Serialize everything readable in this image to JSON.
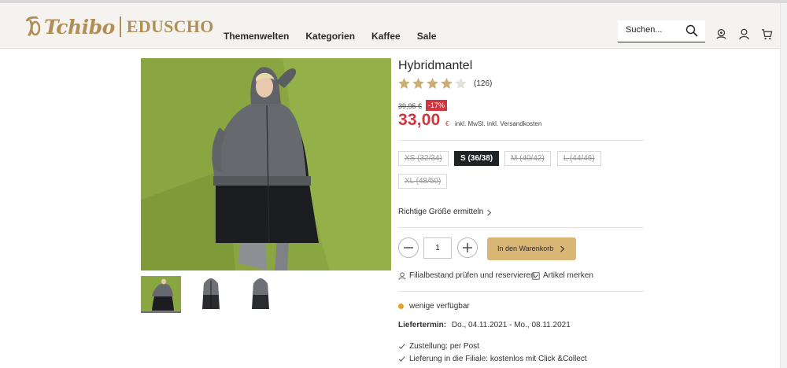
{
  "header": {
    "logo_primary": "Tchibo",
    "logo_secondary": "EDUSCHO",
    "nav": [
      "Themenwelten",
      "Kategorien",
      "Kaffee",
      "Sale"
    ],
    "search_placeholder": "Suchen...",
    "icons": [
      "search-icon",
      "store-locator-icon",
      "account-icon",
      "cart-icon"
    ]
  },
  "gallery": {
    "thumbnails": [
      "thumbnail-model",
      "thumbnail-coat-front",
      "thumbnail-coat-back"
    ],
    "active_index": 0
  },
  "product": {
    "title": "Hybridmantel",
    "rating": 4,
    "rating_max": 5,
    "review_count": "(126)",
    "old_price": "39,95 €",
    "discount": "-17%",
    "price": "33,00",
    "currency": "€",
    "price_note": "inkl. MwSt. inkl. Versandkosten",
    "sizes": [
      {
        "label": "XS (32/34)",
        "available": false,
        "selected": false
      },
      {
        "label": "S (36/38)",
        "available": true,
        "selected": true
      },
      {
        "label": "M (40/42)",
        "available": false,
        "selected": false
      },
      {
        "label": "L (44/46)",
        "available": false,
        "selected": false
      },
      {
        "label": "XL (48/50)",
        "available": false,
        "selected": false
      }
    ],
    "size_link": "Richtige Größe ermitteln",
    "quantity": "1",
    "cart_button": "In den Warenkorb",
    "filial_link": "Filialbestand prüfen und reservieren",
    "merken_link": "Artikel merken",
    "availability": "wenige verfügbar",
    "delivery_label": "Liefertermin:",
    "delivery_dates": "Do., 04.11.2021 - Mo., 08.11.2021",
    "shipping_options": [
      "Zustellung: per Post",
      "Lieferung in die Filiale: kostenlos mit Click &Collect"
    ]
  },
  "colors": {
    "brand_gold": "#b08f55",
    "price_red": "#d0353c",
    "cart_button": "#d9b674",
    "availability_dot": "#e3a230",
    "selected_size": "#1e2225"
  }
}
